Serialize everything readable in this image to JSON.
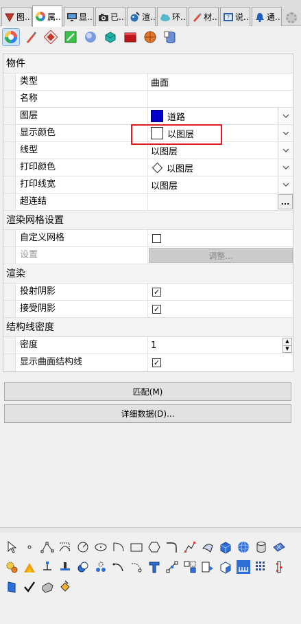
{
  "tabs": [
    {
      "label": "图...",
      "icon": "layer-tab-icon",
      "active": false
    },
    {
      "label": "属...",
      "icon": "properties-tab-icon",
      "active": true
    },
    {
      "label": "显...",
      "icon": "display-tab-icon",
      "active": false
    },
    {
      "label": "已...",
      "icon": "named-view-tab-icon",
      "active": false
    },
    {
      "label": "渲...",
      "icon": "render-tab-icon",
      "active": false
    },
    {
      "label": "环...",
      "icon": "environment-tab-icon",
      "active": false
    },
    {
      "label": "材...",
      "icon": "material-tab-icon",
      "active": false
    },
    {
      "label": "说...",
      "icon": "help-tab-icon",
      "active": false
    },
    {
      "label": "通...",
      "icon": "notification-tab-icon",
      "active": false
    }
  ],
  "sections": {
    "object": "物件",
    "render_mesh": "渲染网格设置",
    "render": "渲染",
    "isocurve": "结构线密度"
  },
  "props": {
    "type": {
      "label": "类型",
      "value": "曲面"
    },
    "name": {
      "label": "名称",
      "value": ""
    },
    "layer": {
      "label": "图层",
      "value": "道路",
      "color": "#0000c8"
    },
    "display_color": {
      "label": "显示颜色",
      "value": "以图层",
      "color": "#ffffff"
    },
    "linetype": {
      "label": "线型",
      "value": "以图层"
    },
    "print_color": {
      "label": "打印颜色",
      "value": "以图层"
    },
    "print_width": {
      "label": "打印线宽",
      "value": "以图层"
    },
    "hyperlink": {
      "label": "超连结",
      "value": "",
      "button": "..."
    },
    "custom_mesh": {
      "label": "自定义网格",
      "checked": false
    },
    "settings": {
      "label": "设置",
      "button": "调整..."
    },
    "cast_shadows": {
      "label": "投射阴影",
      "checked": true
    },
    "receive_shadows": {
      "label": "接受阴影",
      "checked": true
    },
    "density": {
      "label": "密度",
      "value": "1"
    },
    "show_isocurves": {
      "label": "显示曲面结构线",
      "checked": true
    }
  },
  "buttons": {
    "match": "匹配(M)",
    "details": "详细数据(D)..."
  },
  "check_glyph": "✓",
  "highlight_color": "#e8191c"
}
